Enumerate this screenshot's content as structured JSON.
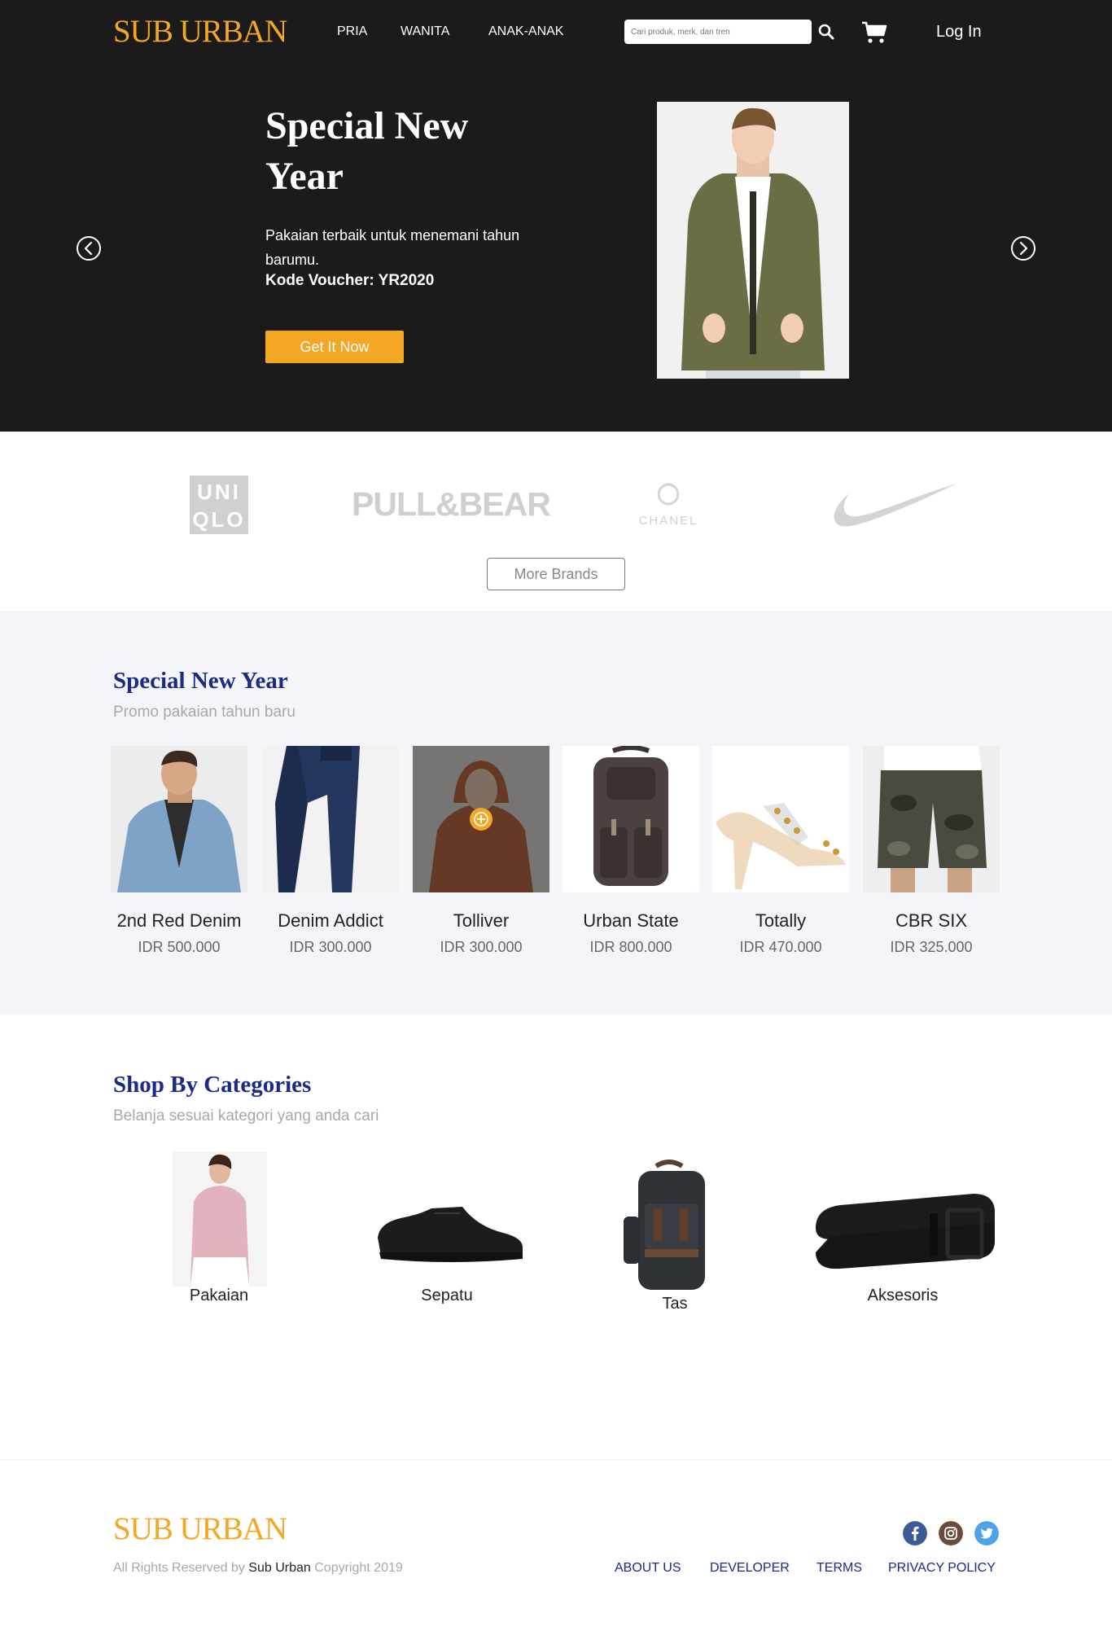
{
  "header": {
    "logo": "SUB URBAN",
    "nav": [
      "PRIA",
      "WANITA",
      "ANAK-ANAK"
    ],
    "search_placeholder": "Cari produk, merk, dan tren",
    "login": "Log In"
  },
  "hero": {
    "title": "Special New Year",
    "description": "Pakaian terbaik untuk menemani tahun barumu.",
    "voucher": "Kode Voucher: YR2020",
    "cta": "Get It Now"
  },
  "brands": {
    "logos": [
      "UNI QLO",
      "PULL&BEAR",
      "CHANEL",
      "nike-swoosh"
    ],
    "more_button": "More Brands"
  },
  "promo": {
    "title": "Special New Year",
    "subtitle": "Promo pakaian tahun baru",
    "products": [
      {
        "name": "2nd Red Denim",
        "price": "IDR 500.000"
      },
      {
        "name": "Denim Addict",
        "price": "IDR 300.000"
      },
      {
        "name": "Tolliver",
        "price": "IDR 300.000"
      },
      {
        "name": "Urban State",
        "price": "IDR 800.000"
      },
      {
        "name": "Totally",
        "price": "IDR 470.000"
      },
      {
        "name": "CBR SIX",
        "price": "IDR 325.000"
      }
    ]
  },
  "categories": {
    "title": "Shop By Categories",
    "subtitle": "Belanja sesuai kategori yang anda cari",
    "items": [
      {
        "label": "Pakaian"
      },
      {
        "label": "Sepatu"
      },
      {
        "label": "Tas"
      },
      {
        "label": "Aksesoris"
      }
    ]
  },
  "footer": {
    "logo": "SUB URBAN",
    "copyright_prefix": "All Rights Reserved by",
    "copyright_brand": "Sub Urban",
    "copyright_suffix": "Copyright 2019",
    "links": [
      "ABOUT US",
      "DEVELOPER",
      "TERMS",
      "PRIVACY POLICY"
    ],
    "social": [
      "facebook-icon",
      "instagram-icon",
      "twitter-icon"
    ]
  },
  "colors": {
    "accent": "#f5a623",
    "navy": "#1b2a87",
    "dark_bg": "#1c1b1c",
    "light_bg": "#f4f5f9"
  }
}
